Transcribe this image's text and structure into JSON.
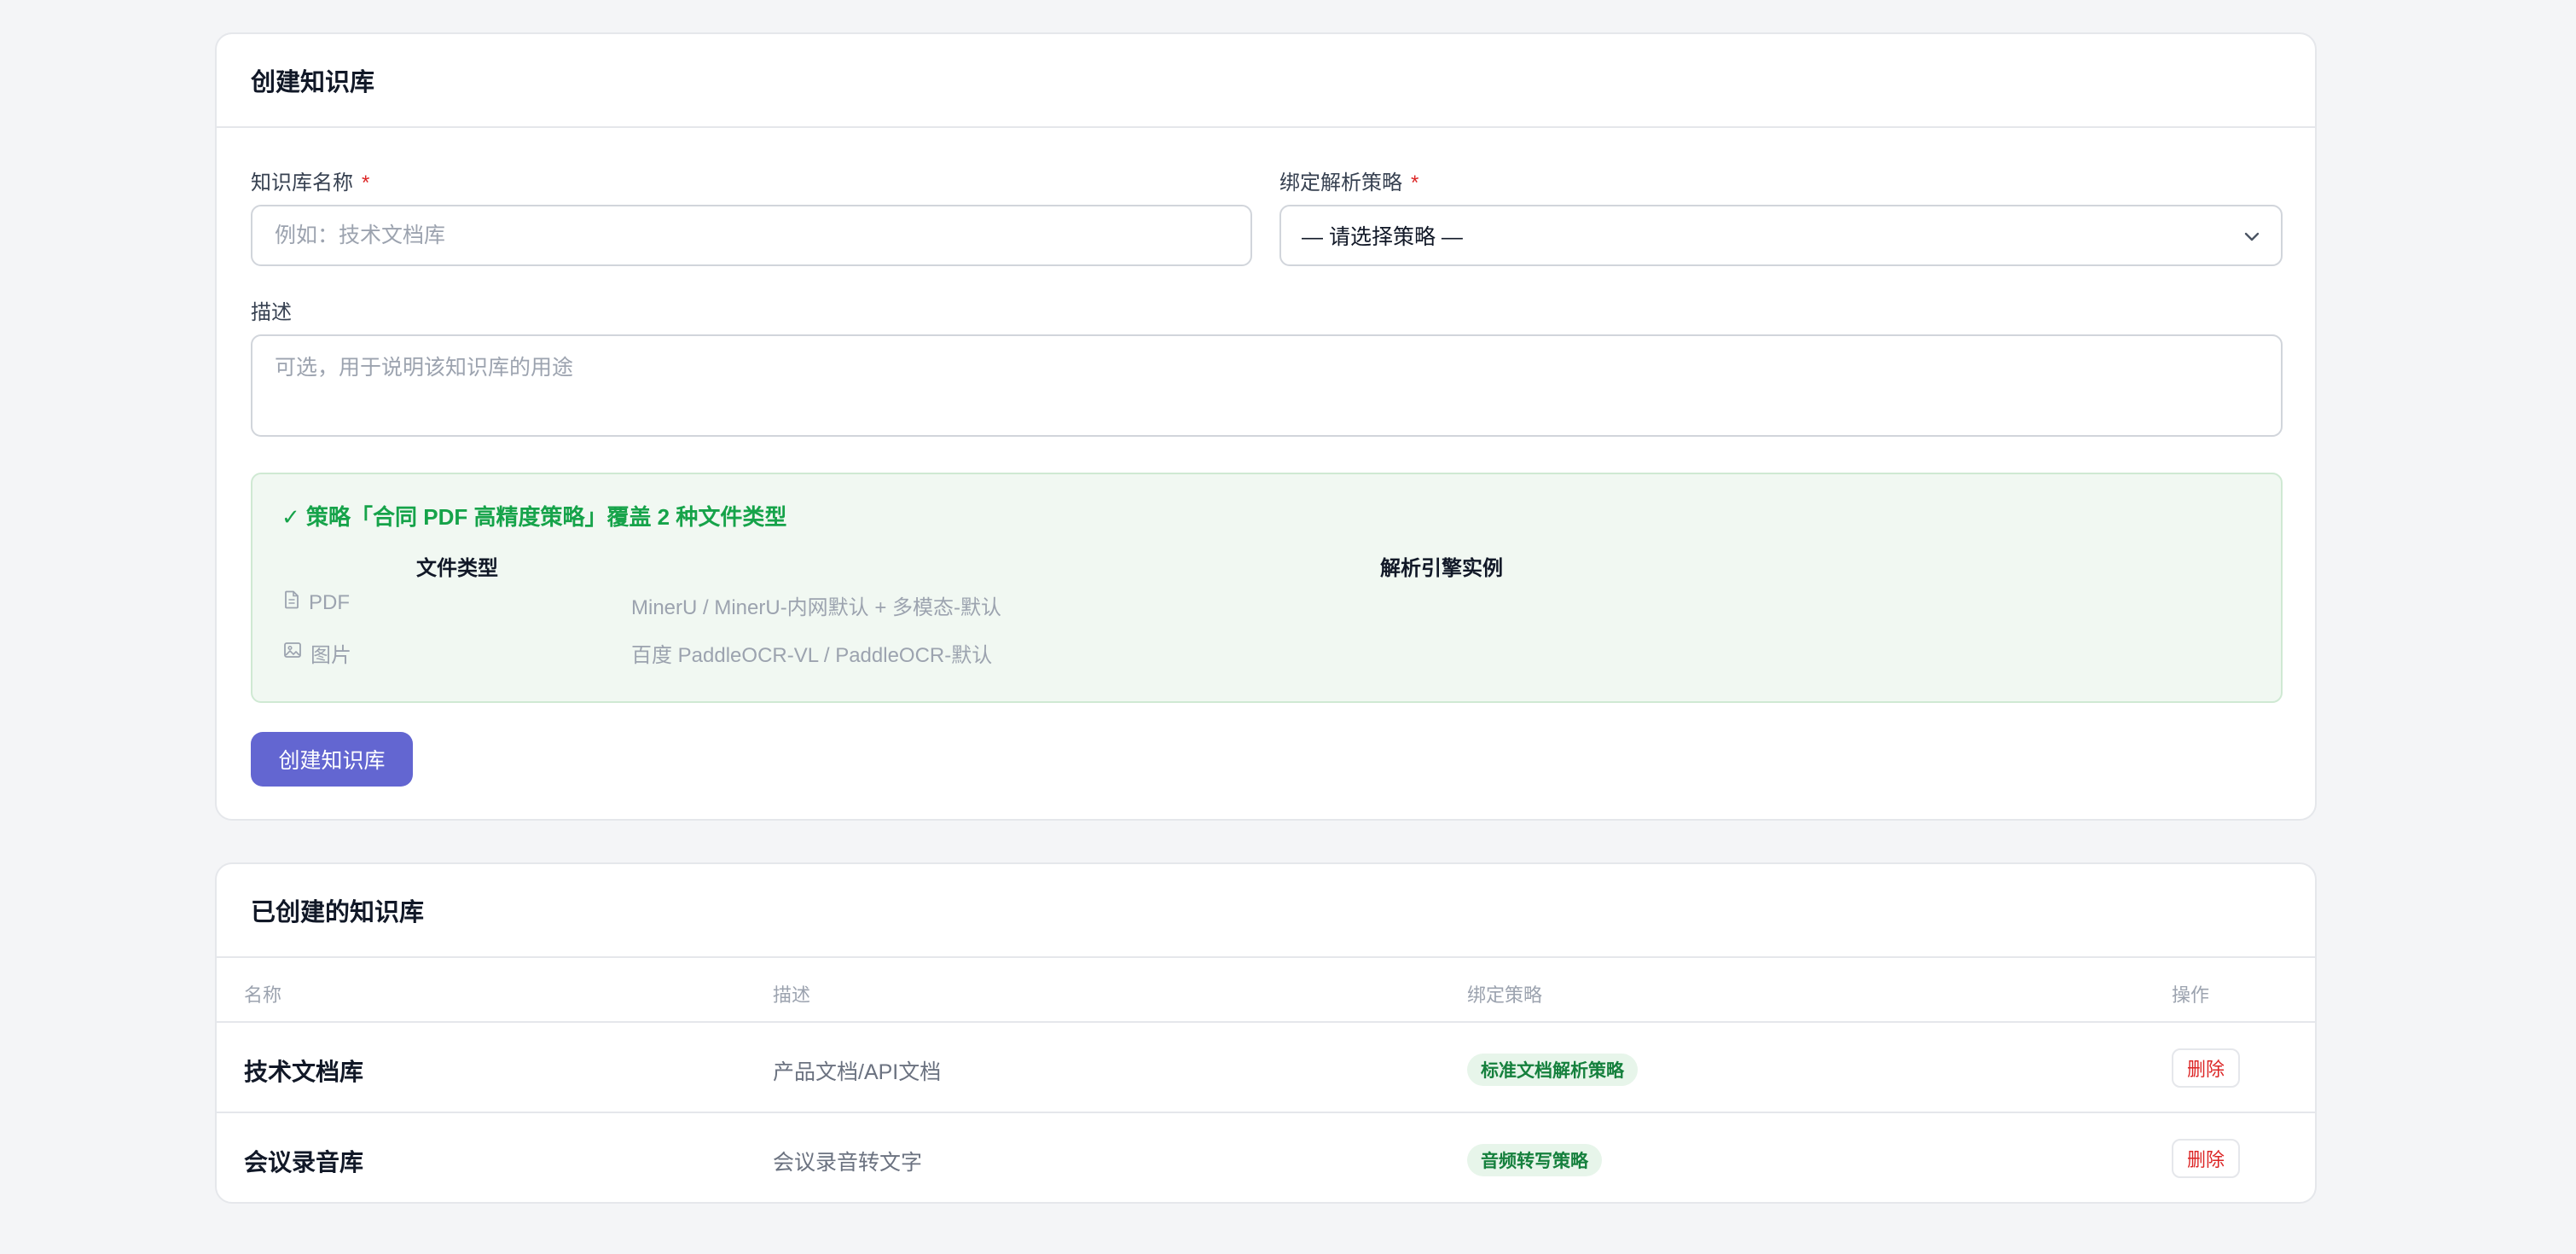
{
  "create_card": {
    "title": "创建知识库",
    "name_label": "知识库名称",
    "required_mark": "*",
    "name_placeholder": "例如：技术文档库",
    "strategy_label": "绑定解析策略",
    "strategy_selected": "— 请选择策略 —",
    "desc_label": "描述",
    "desc_placeholder": "可选，用于说明该知识库的用途",
    "strategy_summary": {
      "title": "✓ 策略「合同 PDF 高精度策略」覆盖 2 种文件类型",
      "col_type": "文件类型",
      "col_engine": "解析引擎实例",
      "rows": [
        {
          "type": "PDF",
          "icon": "file-icon",
          "engine": "MinerU / MinerU-内网默认 + 多模态-默认"
        },
        {
          "type": "图片",
          "icon": "image-icon",
          "engine": "百度 PaddleOCR-VL / PaddleOCR-默认"
        }
      ]
    },
    "submit_label": "创建知识库"
  },
  "list_card": {
    "title": "已创建的知识库",
    "columns": [
      "名称",
      "描述",
      "绑定策略",
      "操作"
    ],
    "rows": [
      {
        "name": "技术文档库",
        "desc": "产品文档/API文档",
        "strategy": "标准文档解析策略",
        "action": "删除"
      },
      {
        "name": "会议录音库",
        "desc": "会议录音转文字",
        "strategy": "音频转写策略",
        "action": "删除"
      }
    ]
  },
  "colors": {
    "primary": "#6366d1",
    "success": "#16a34a",
    "danger": "#dc2626"
  }
}
